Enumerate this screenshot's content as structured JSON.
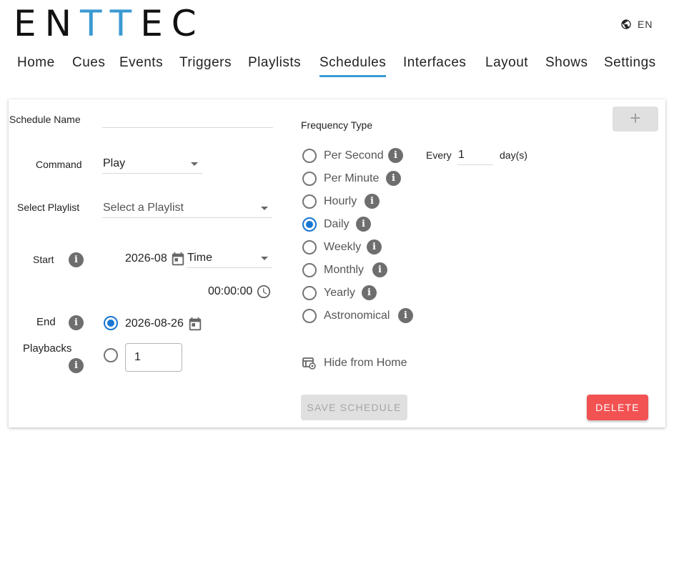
{
  "brand": {
    "logo_part1": "EN",
    "logo_part2": "TT",
    "logo_part3": "EC"
  },
  "language": {
    "label": "EN"
  },
  "nav": {
    "items": [
      {
        "label": "Home"
      },
      {
        "label": "Cues"
      },
      {
        "label": "Events"
      },
      {
        "label": "Triggers"
      },
      {
        "label": "Playlists"
      },
      {
        "label": "Schedules",
        "active": true
      },
      {
        "label": "Interfaces"
      },
      {
        "label": "Layout"
      },
      {
        "label": "Shows"
      },
      {
        "label": "Settings"
      }
    ]
  },
  "form": {
    "schedule_name_label": "Schedule Name",
    "schedule_name_value": "",
    "command_label": "Command",
    "command_value": "Play",
    "playlist_label": "Select Playlist",
    "playlist_placeholder": "Select a Playlist",
    "start_label": "Start",
    "start_date": "2026-08",
    "start_mode": "Time",
    "start_time": "00:00:00",
    "end_label": "End",
    "end_date": "2026-08-26",
    "end_date_selected": true,
    "playbacks_label": "Playbacks",
    "playbacks_value": "1",
    "playbacks_selected": false
  },
  "frequency": {
    "title": "Frequency Type",
    "options": [
      {
        "label": "Per Second",
        "selected": false
      },
      {
        "label": "Per Minute",
        "selected": false
      },
      {
        "label": "Hourly",
        "selected": false
      },
      {
        "label": "Daily",
        "selected": true
      },
      {
        "label": "Weekly",
        "selected": false
      },
      {
        "label": "Monthly",
        "selected": false
      },
      {
        "label": "Yearly",
        "selected": false
      },
      {
        "label": "Astronomical",
        "selected": false
      }
    ],
    "every_label": "Every",
    "every_value": "1",
    "unit_label": "day(s)"
  },
  "hide_from_home": {
    "label": "Hide from Home"
  },
  "buttons": {
    "add_label": "+",
    "save_label": "SAVE SCHEDULE",
    "delete_label": "DELETE"
  },
  "icons": {
    "info": "info-icon",
    "calendar": "calendar-icon",
    "clock": "clock-icon",
    "globe": "globe-icon",
    "hide": "hide-from-home-icon"
  },
  "colors": {
    "accent": "#3c9ad2",
    "radio_selected": "#1976d2",
    "delete": "#f25252",
    "disabled": "#e0e0e0"
  }
}
